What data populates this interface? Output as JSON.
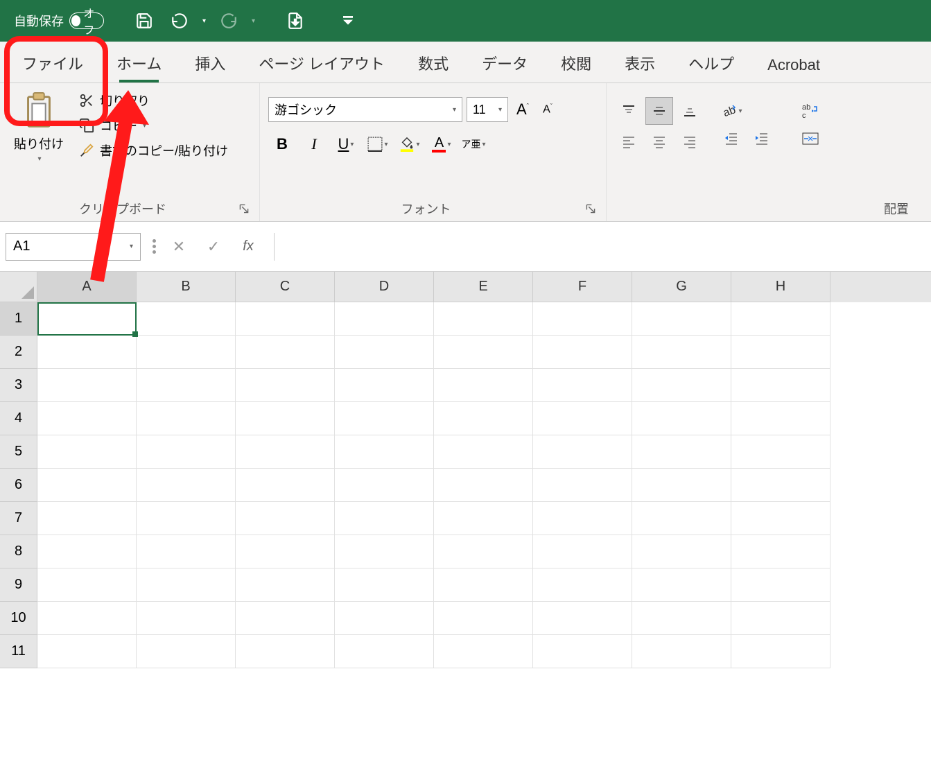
{
  "titlebar": {
    "autosave_label": "自動保存",
    "autosave_state": "オフ"
  },
  "tabs": [
    {
      "id": "file",
      "label": "ファイル"
    },
    {
      "id": "home",
      "label": "ホーム",
      "active": true
    },
    {
      "id": "insert",
      "label": "挿入"
    },
    {
      "id": "pagelayout",
      "label": "ページ レイアウト"
    },
    {
      "id": "formulas",
      "label": "数式"
    },
    {
      "id": "data",
      "label": "データ"
    },
    {
      "id": "review",
      "label": "校閲"
    },
    {
      "id": "view",
      "label": "表示"
    },
    {
      "id": "help",
      "label": "ヘルプ"
    },
    {
      "id": "acrobat",
      "label": "Acrobat"
    }
  ],
  "ribbon": {
    "clipboard": {
      "label": "クリップボード",
      "paste": "貼り付け",
      "cut": "切り取り",
      "copy": "コピー",
      "format_painter": "書式のコピー/貼り付け"
    },
    "font": {
      "label": "フォント",
      "name": "游ゴシック",
      "size": "11",
      "phonetic": "ア亜"
    },
    "alignment": {
      "label": "配置"
    }
  },
  "namebox": "A1",
  "formula": "",
  "columns": [
    "A",
    "B",
    "C",
    "D",
    "E",
    "F",
    "G",
    "H"
  ],
  "rows": [
    "1",
    "2",
    "3",
    "4",
    "5",
    "6",
    "7",
    "8",
    "9",
    "10",
    "11"
  ],
  "selected_cell": {
    "row": 0,
    "col": 0
  }
}
